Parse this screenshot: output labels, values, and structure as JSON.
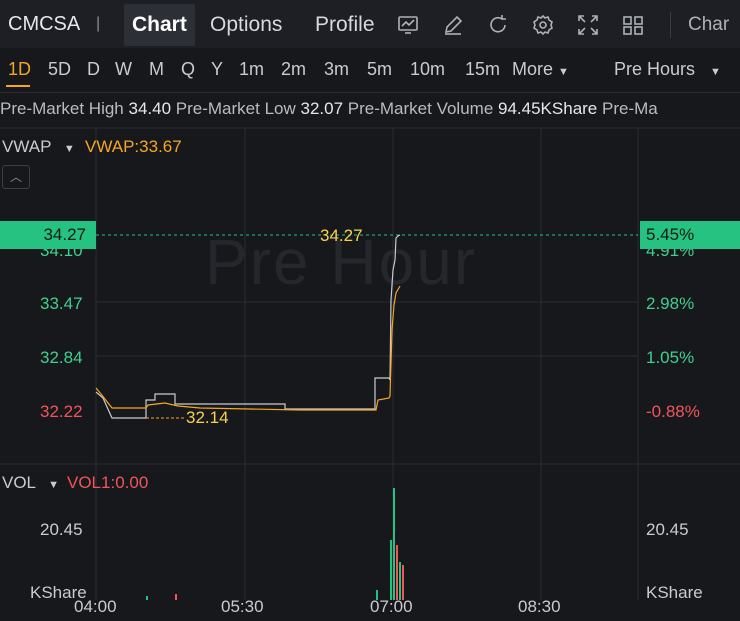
{
  "header": {
    "symbol": "CMCSA",
    "separator": "|",
    "tabs": [
      "Chart",
      "Options",
      "Profile"
    ],
    "active_tab": "Chart",
    "chart_label": "Char"
  },
  "periods": {
    "items": [
      "1D",
      "5D",
      "D",
      "W",
      "M",
      "Q",
      "Y",
      "1m",
      "2m",
      "3m",
      "5m",
      "10m",
      "15m"
    ],
    "active": "1D",
    "more_label": "More",
    "session_label": "Pre Hours"
  },
  "info": {
    "high_label": "Pre-Market High",
    "high_value": "34.40",
    "low_label": "Pre-Market Low",
    "low_value": "32.07",
    "volume_label": "Pre-Market Volume",
    "volume_value": "94.45KShare",
    "trailing": "Pre-Ma"
  },
  "indicators": {
    "main_name": "VWAP",
    "main_value": "VWAP:33.67",
    "vol_name": "VOL",
    "vol_value": "VOL1:0.00"
  },
  "price_axis": {
    "current": "34.27",
    "current_pct": "5.45%",
    "labels": [
      "34.10",
      "33.47",
      "32.84",
      "32.22"
    ],
    "pct_labels": [
      "4.91%",
      "2.98%",
      "1.05%",
      "-0.88%"
    ],
    "low_marker": "32.14",
    "high_marker": "34.27"
  },
  "volume_axis": {
    "label": "20.45",
    "unit": "KShare"
  },
  "time_axis": [
    "04:00",
    "05:30",
    "07:00",
    "08:30"
  ],
  "watermark": "Pre Hour",
  "colors": {
    "accent": "#f5a623",
    "up": "#26c281",
    "down": "#f2545b",
    "price_line": "#c9cbd0",
    "vwap_line": "#f5a623"
  }
}
